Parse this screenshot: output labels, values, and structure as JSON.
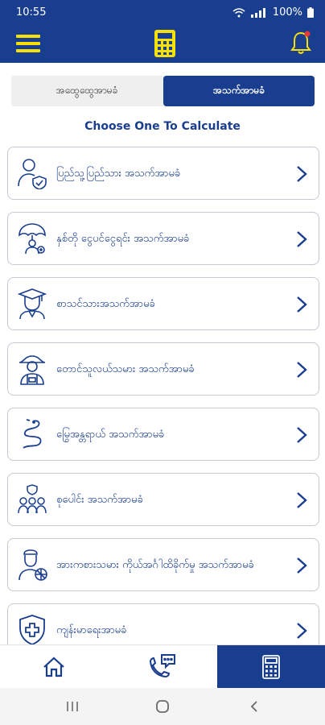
{
  "status": {
    "time": "10:55",
    "battery": "100%"
  },
  "tabs": [
    {
      "label": "အထွေထွေအာမခံ",
      "active": false
    },
    {
      "label": "အသက်အာမခံ",
      "active": true
    }
  ],
  "heading": "Choose One To Calculate",
  "items": [
    {
      "label": "ပြည်သူ့ပြည်သား အသက်အာမခံ",
      "icon": "person-shield-icon"
    },
    {
      "label": "နှစ်တို ငွေပင်ငွေရင်း အသက်အာမခံ",
      "icon": "umbrella-person-icon"
    },
    {
      "label": "စာသင်သားအသက်အာမခံ",
      "icon": "graduate-icon"
    },
    {
      "label": "တောင်သူလယ်သမား အသက်အာမခံ",
      "icon": "farmer-icon"
    },
    {
      "label": "မြွေအန္တရာယ် အသက်အာမခံ",
      "icon": "snake-icon"
    },
    {
      "label": "စုပေါင်း အသက်အာမခံ",
      "icon": "group-icon"
    },
    {
      "label": "အားကစားသမား ကိုယ်အင်္ဂါထိခိုက်မှု အသက်အာမခံ",
      "icon": "athlete-icon"
    },
    {
      "label": "ကျန်းမာရေးအာမခံ",
      "icon": "health-shield-icon"
    }
  ],
  "colors": {
    "primary": "#1a3e8f",
    "accent": "#f5e10a",
    "alert": "#e53935"
  }
}
